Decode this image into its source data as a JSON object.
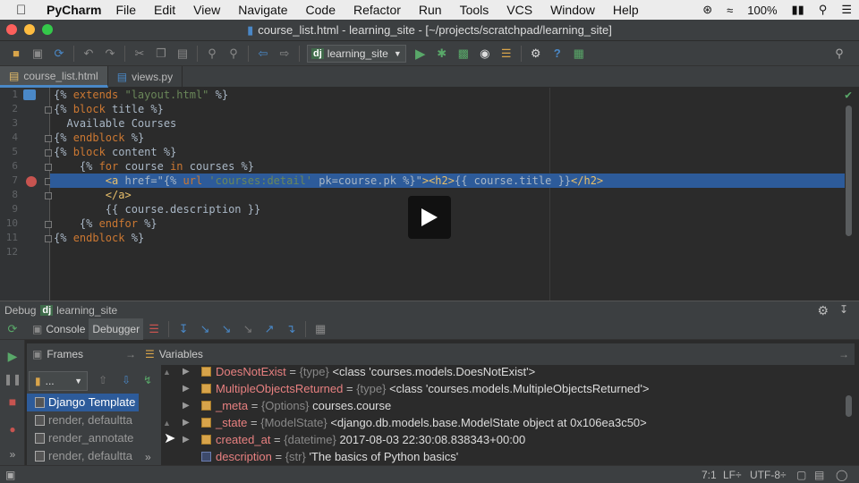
{
  "menubar": {
    "app_name": "PyCharm",
    "items": [
      "File",
      "Edit",
      "View",
      "Navigate",
      "Code",
      "Refactor",
      "Run",
      "Tools",
      "VCS",
      "Window",
      "Help"
    ],
    "battery": "100%"
  },
  "window": {
    "title": "course_list.html - learning_site - [~/projects/scratchpad/learning_site]"
  },
  "toolbar": {
    "run_config": "learning_site"
  },
  "tabs": [
    {
      "label": "course_list.html"
    },
    {
      "label": "views.py"
    }
  ],
  "editor": {
    "line_numbers": [
      "1",
      "2",
      "3",
      "4",
      "5",
      "6",
      "7",
      "8",
      "9",
      "10",
      "11",
      "12"
    ],
    "lines": [
      [
        {
          "t": "{% ",
          "c": "tx"
        },
        {
          "t": "extends ",
          "c": "kw"
        },
        {
          "t": "\"layout.html\"",
          "c": "str"
        },
        {
          "t": " %}",
          "c": "tx"
        }
      ],
      [
        {
          "t": "{% ",
          "c": "tx"
        },
        {
          "t": "block ",
          "c": "kw"
        },
        {
          "t": "title %}",
          "c": "tx"
        }
      ],
      [
        {
          "t": "  Available Courses",
          "c": "tx"
        }
      ],
      [
        {
          "t": "{% ",
          "c": "tx"
        },
        {
          "t": "endblock ",
          "c": "kw"
        },
        {
          "t": "%}",
          "c": "tx"
        }
      ],
      [
        {
          "t": "{% ",
          "c": "tx"
        },
        {
          "t": "block ",
          "c": "kw"
        },
        {
          "t": "content %}",
          "c": "tx"
        }
      ],
      [
        {
          "t": "    {% ",
          "c": "tx"
        },
        {
          "t": "for ",
          "c": "kw"
        },
        {
          "t": "course ",
          "c": "tx"
        },
        {
          "t": "in ",
          "c": "kw"
        },
        {
          "t": "courses %}",
          "c": "tx"
        }
      ],
      [
        {
          "t": "        ",
          "c": "tx"
        },
        {
          "t": "<a ",
          "c": "tag"
        },
        {
          "t": "href=\"{% ",
          "c": "tx"
        },
        {
          "t": "url ",
          "c": "kw"
        },
        {
          "t": "'courses:detail'",
          "c": "str"
        },
        {
          "t": " pk=course.pk %}\"",
          "c": "tx"
        },
        {
          "t": "><h2>",
          "c": "tag"
        },
        {
          "t": "{{ course.title }}",
          "c": "tx"
        },
        {
          "t": "</h2>",
          "c": "tag"
        }
      ],
      [
        {
          "t": "        ",
          "c": "tx"
        },
        {
          "t": "</a>",
          "c": "tag"
        }
      ],
      [
        {
          "t": "        {{ course.description }}",
          "c": "tx"
        }
      ],
      [
        {
          "t": "    {% ",
          "c": "tx"
        },
        {
          "t": "endfor ",
          "c": "kw"
        },
        {
          "t": "%}",
          "c": "tx"
        }
      ],
      [
        {
          "t": "{% ",
          "c": "tx"
        },
        {
          "t": "endblock ",
          "c": "kw"
        },
        {
          "t": "%}",
          "c": "tx"
        }
      ],
      []
    ]
  },
  "debug": {
    "label": "Debug",
    "config": "learning_site",
    "tab_console": "Console",
    "tab_debugger": "Debugger",
    "frames_title": "Frames",
    "variables_title": "Variables",
    "thread_selector": "...",
    "frames": [
      "Django Template",
      "render, defaultta",
      "render_annotate",
      "render, defaultta"
    ],
    "variables": [
      {
        "name": "DoesNotExist",
        "type": "{type}",
        "value": "<class 'courses.models.DoesNotExist'>",
        "icon": "obj"
      },
      {
        "name": "MultipleObjectsReturned",
        "type": "{type}",
        "value": "<class 'courses.models.MultipleObjectsReturned'>",
        "icon": "obj"
      },
      {
        "name": "_meta",
        "type": "{Options}",
        "value": "courses.course",
        "icon": "obj"
      },
      {
        "name": "_state",
        "type": "{ModelState}",
        "value": "<django.db.models.base.ModelState object at 0x106ea3c50>",
        "icon": "obj"
      },
      {
        "name": "created_at",
        "type": "{datetime}",
        "value": "2017-08-03 22:30:08.838343+00:00",
        "icon": "obj"
      },
      {
        "name": "description",
        "type": "{str}",
        "value": "'The basics of Python basics'",
        "icon": "str"
      }
    ]
  },
  "status": {
    "position": "7:1",
    "line_sep": "LF÷",
    "encoding": "UTF-8÷"
  },
  "colors": {
    "accent": "#4a88c7",
    "selection": "#2d5b9a",
    "breakpoint": "#c75450"
  }
}
